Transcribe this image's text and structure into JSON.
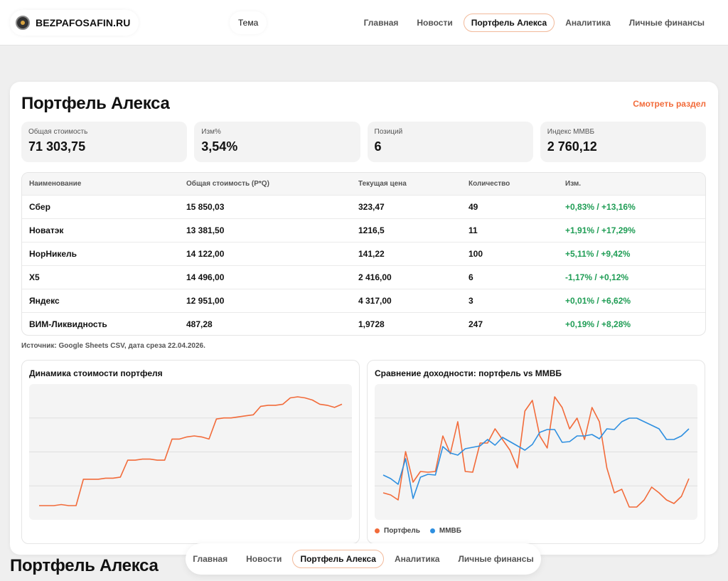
{
  "header": {
    "brand": "BEZPAFOSAFIN.RU",
    "theme_label": "Тема",
    "nav": [
      "Главная",
      "Новости",
      "Портфель Алекса",
      "Аналитика",
      "Личные финансы"
    ],
    "active_nav": "Портфель Алекса"
  },
  "portfolio": {
    "title": "Портфель Алекса",
    "see_all": "Смотреть раздел",
    "stats": [
      {
        "label": "Общая стоимость",
        "value": "71 303,75"
      },
      {
        "label": "Изм%",
        "value": "3,54%"
      },
      {
        "label": "Позиций",
        "value": "6"
      },
      {
        "label": "Индекс ММВБ",
        "value": "2 760,12"
      }
    ],
    "table": {
      "headers": [
        "Наименование",
        "Общая стоимость (P*Q)",
        "Текущая цена",
        "Количество",
        "Изм."
      ],
      "rows": [
        [
          "Сбер",
          "15 850,03",
          "323,47",
          "49",
          "+0,83% / +13,16%"
        ],
        [
          "Новатэк",
          "13 381,50",
          "1216,5",
          "11",
          "+1,91% / +17,29%"
        ],
        [
          "НорНикель",
          "14 122,00",
          "141,22",
          "100",
          "+5,11% / +9,42%"
        ],
        [
          "X5",
          "14 496,00",
          "2 416,00",
          "6",
          "-1,17% / +0,12%"
        ],
        [
          "Яндекс",
          "12 951,00",
          "4 317,00",
          "3",
          "+0,01% / +6,62%"
        ],
        [
          "ВИМ-Ликвидность",
          "487,28",
          "1,9728",
          "247",
          "+0,19% / +8,28%"
        ]
      ]
    },
    "source": "Источник: Google Sheets CSV, дата среза 22.04.2026."
  },
  "colors": {
    "accent": "#f26b3a",
    "positive": "#1f9d55",
    "index_line": "#2e8fe0"
  },
  "chart_data": [
    {
      "type": "line",
      "title": "Динамика стоимости портфеля",
      "x": [
        1,
        2,
        3,
        4,
        5,
        6,
        7,
        8,
        9,
        10,
        11,
        12,
        13,
        14,
        15,
        16,
        17,
        18,
        19,
        20,
        21,
        22,
        23,
        24,
        25,
        26,
        27,
        28,
        29,
        30,
        31,
        32,
        33,
        34,
        35,
        36,
        37,
        38,
        39,
        40,
        41,
        42
      ],
      "series": [
        {
          "name": "",
          "values": [
            5,
            5,
            5,
            6,
            5,
            5,
            30,
            30,
            30,
            31,
            31,
            32,
            48,
            48,
            49,
            49,
            48,
            48,
            68,
            68,
            70,
            71,
            70,
            68,
            87,
            88,
            88,
            89,
            90,
            91,
            99,
            100,
            100,
            101,
            107,
            108,
            107,
            105,
            101,
            100,
            98,
            101
          ]
        }
      ]
    },
    {
      "type": "line",
      "title": "Сравнение доходности: портфель vs ММВБ",
      "x": [
        1,
        2,
        3,
        4,
        5,
        6,
        7,
        8,
        9,
        10,
        11,
        12,
        13,
        14,
        15,
        16,
        17,
        18,
        19,
        20,
        21,
        22,
        23,
        24,
        25,
        26,
        27,
        28,
        29,
        30,
        31,
        32,
        33,
        34,
        35,
        36,
        37,
        38,
        39,
        40,
        41,
        42
      ],
      "series": [
        {
          "name": "Портфель",
          "values": [
            -1.0,
            -1.3,
            -2.0,
            4.8,
            0.5,
            2.0,
            1.9,
            2.0,
            7.0,
            4.5,
            9.0,
            2.0,
            1.9,
            6.0,
            6.0,
            8.0,
            6.5,
            5.0,
            2.5,
            10.5,
            12.0,
            7.0,
            5.3,
            12.5,
            11.0,
            8.0,
            9.5,
            6.5,
            11.0,
            9.0,
            2.5,
            -1.0,
            -0.5,
            -3.0,
            -3.0,
            -2.0,
            -0.2,
            -1.0,
            -2.0,
            -2.5,
            -1.5,
            1.0
          ]
        },
        {
          "name": "ММВБ",
          "values": [
            1.5,
            1.0,
            0.2,
            3.8,
            -1.8,
            1.2,
            1.6,
            1.5,
            5.5,
            4.6,
            4.3,
            5.2,
            5.4,
            5.6,
            6.5,
            5.7,
            6.8,
            6.2,
            5.6,
            5.0,
            5.8,
            7.5,
            7.9,
            7.9,
            6.1,
            6.2,
            7.0,
            7.0,
            7.2,
            6.6,
            8.0,
            7.9,
            9.0,
            9.5,
            9.5,
            9.0,
            8.5,
            8.0,
            6.5,
            6.5,
            7.0,
            8.0
          ]
        }
      ]
    }
  ]
}
